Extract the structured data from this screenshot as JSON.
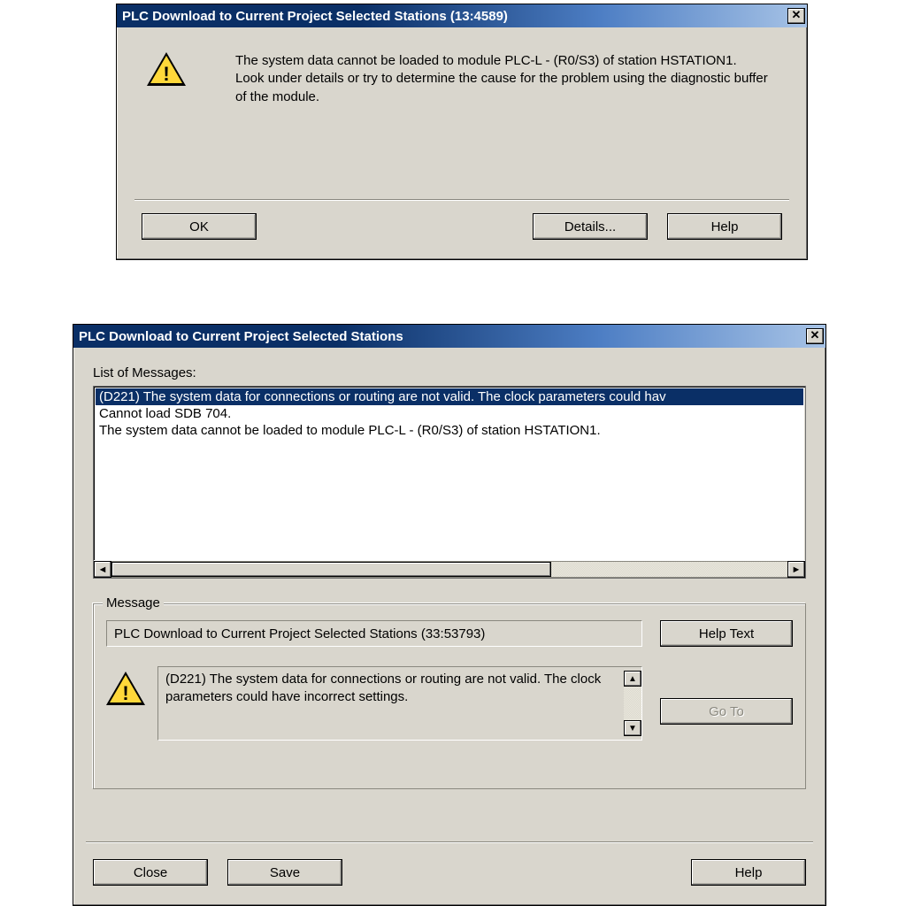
{
  "dialog1": {
    "title": "PLC Download to Current Project Selected Stations (13:4589)",
    "close_glyph": "✕",
    "message_line1": "The system data cannot be loaded to module PLC-L - (R0/S3) of station HSTATION1.",
    "message_line2": "Look under details or try to determine the cause for the problem using the diagnostic buffer of the module.",
    "ok_label": "OK",
    "details_label": "Details...",
    "help_label": "Help"
  },
  "dialog2": {
    "title": "PLC Download to Current Project Selected Stations",
    "close_glyph": "✕",
    "list_label": "List of Messages:",
    "messages": [
      "(D221) The system data for connections or routing are not valid. The clock parameters could hav",
      "Cannot load SDB 704.",
      "The system data cannot be loaded to module PLC-L - (R0/S3) of station HSTATION1."
    ],
    "selected_index": 0,
    "group_label": "Message",
    "msg_header": "PLC Download to Current Project Selected Stations (33:53793)",
    "detail_text": "(D221) The system data for connections or routing are not valid. The clock parameters could have incorrect settings.",
    "helptext_label": "Help Text",
    "goto_label": "Go To",
    "close_label": "Close",
    "save_label": "Save",
    "help_label": "Help",
    "scroll_left": "◄",
    "scroll_right": "►",
    "scroll_up": "▲",
    "scroll_down": "▼"
  }
}
